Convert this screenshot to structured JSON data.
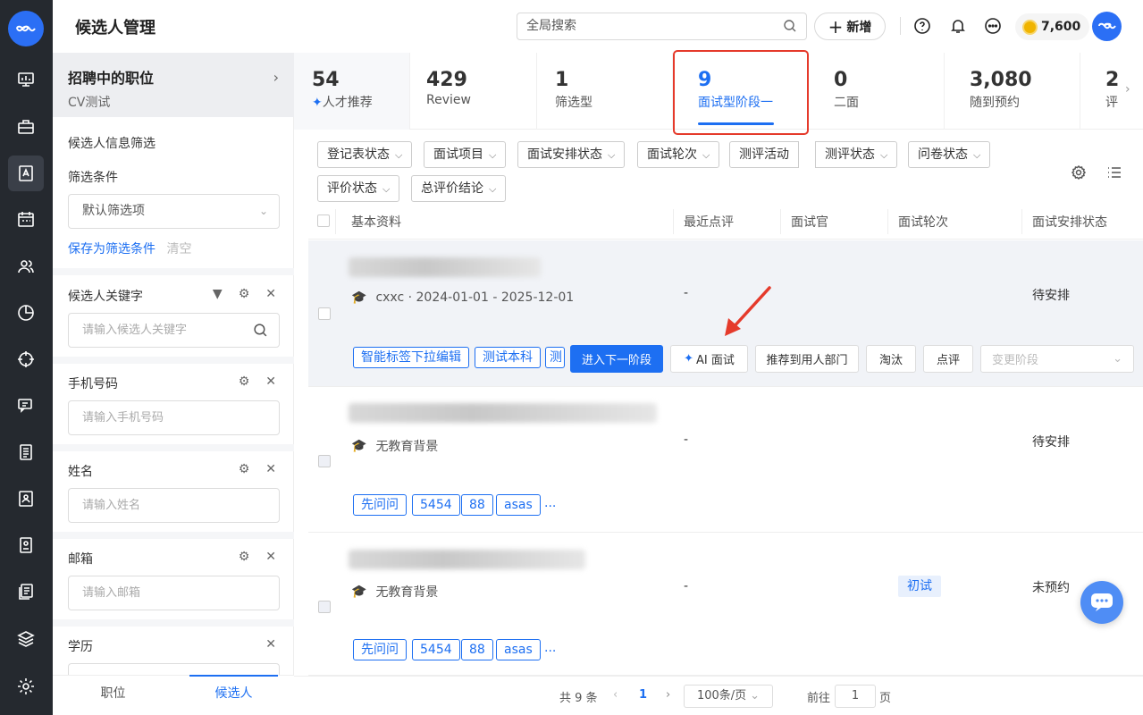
{
  "nav": {
    "items": [
      "monitor",
      "briefcase",
      "candidate",
      "calendar",
      "users",
      "pie",
      "target",
      "message",
      "list",
      "contact",
      "badge",
      "doc",
      "layers",
      "settings"
    ],
    "active": "candidate"
  },
  "topbar": {
    "title": "候选人管理",
    "search_placeholder": "全局搜索",
    "new_label": "新增",
    "coins": "7,600"
  },
  "filter": {
    "job_title": "招聘中的职位",
    "job_sub": "CV测试",
    "section_title": "候选人信息筛选",
    "conditions_label": "筛选条件",
    "conditions_value": "默认筛选项",
    "save_filter": "保存为筛选条件",
    "clear": "清空",
    "keyword_label": "候选人关键字",
    "keyword_placeholder": "请输入候选人关键字",
    "phone_label": "手机号码",
    "phone_placeholder": "请输入手机号码",
    "name_label": "姓名",
    "name_placeholder": "请输入姓名",
    "email_label": "邮箱",
    "email_placeholder": "请输入邮箱",
    "edu_label": "学历"
  },
  "bottom_tabs": {
    "jobs": "职位",
    "candidates": "候选人"
  },
  "stats": [
    {
      "num": "54",
      "label": "人才推荐"
    },
    {
      "num": "429",
      "label": "Review"
    },
    {
      "num": "1",
      "label": "筛选型"
    },
    {
      "num": "9",
      "label": "面试型阶段一"
    },
    {
      "num": "0",
      "label": "二面"
    },
    {
      "num": "3,080",
      "label": "随到预约"
    },
    {
      "num": "2",
      "label": "评"
    }
  ],
  "chips": [
    "登记表状态",
    "面试项目",
    "面试安排状态",
    "面试轮次",
    "测评活动",
    "测评状态",
    "问卷状态",
    "评价状态",
    "总评价结论"
  ],
  "table": {
    "headers": [
      "基本资料",
      "最近点评",
      "面试官",
      "面试轮次",
      "面试安排状态"
    ],
    "rows": [
      {
        "edu": "cxxc · 2024-01-01 - 2025-12-01",
        "comment": "-",
        "round": "",
        "status": "待安排",
        "tags": [
          "智能标签下拉编辑",
          "测试本科",
          "测"
        ]
      },
      {
        "edu": "无教育背景",
        "comment": "-",
        "round": "",
        "status": "待安排",
        "tags": [
          "先问问",
          "5454",
          "88",
          "asas"
        ],
        "more": "..."
      },
      {
        "edu": "无教育背景",
        "comment": "-",
        "round": "初试",
        "status": "未预约",
        "tags": [
          "先问问",
          "5454",
          "88",
          "asas"
        ],
        "more": "..."
      }
    ],
    "actions": {
      "next_stage": "进入下一阶段",
      "ai_interview": "AI 面试",
      "recommend": "推荐到用人部门",
      "eliminate": "淘汰",
      "comment": "点评",
      "change_stage": "变更阶段"
    }
  },
  "pager": {
    "total": "共 9 条",
    "page": "1",
    "per_page": "100条/页",
    "goto": "前往",
    "goto_value": "1",
    "page_unit": "页"
  },
  "colors": {
    "accent": "#1d6ff2",
    "nav_bg": "#25292f",
    "highlight": "#e53a2b"
  }
}
